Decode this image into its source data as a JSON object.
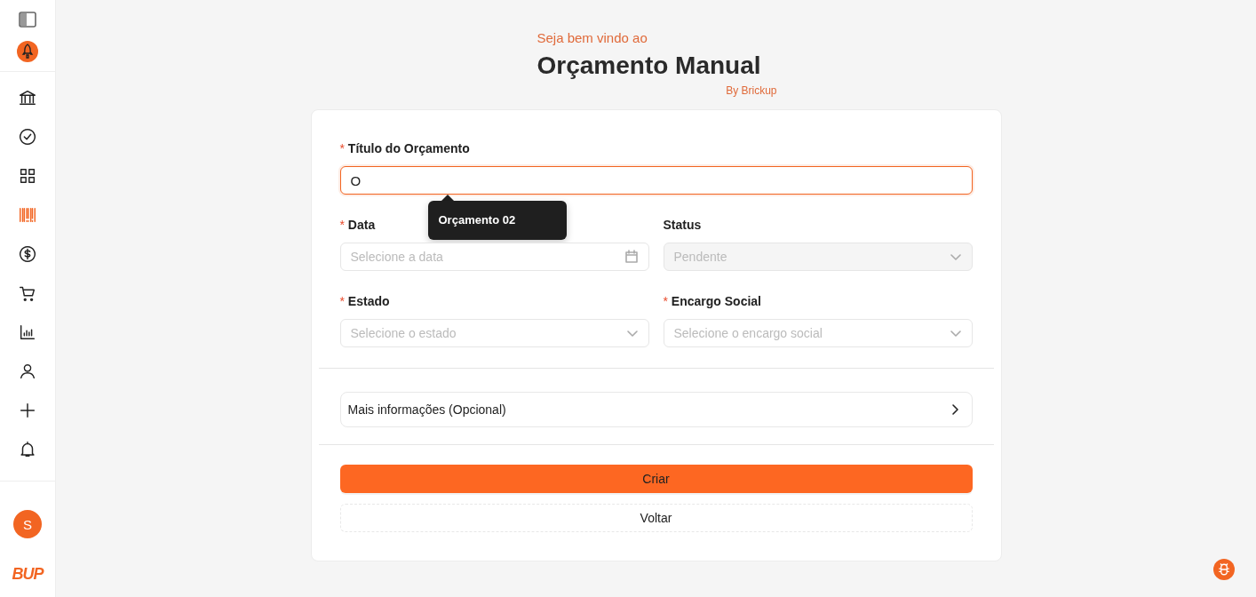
{
  "sidebar": {
    "nav": [
      {
        "kind": "bank",
        "selected": false
      },
      {
        "kind": "check",
        "selected": false
      },
      {
        "kind": "grid",
        "selected": false
      },
      {
        "kind": "barcode",
        "selected": true
      },
      {
        "kind": "dollar",
        "selected": false
      },
      {
        "kind": "cart",
        "selected": false
      },
      {
        "kind": "chart",
        "selected": false
      },
      {
        "kind": "user",
        "selected": false
      },
      {
        "kind": "plus",
        "selected": false
      },
      {
        "kind": "bell",
        "selected": false
      }
    ],
    "avatar": "S",
    "logo": "BUP"
  },
  "header": {
    "greeting": "Seja bem vindo ao",
    "title": "Orçamento Manual",
    "byline": "By Brickup"
  },
  "form": {
    "rows": [
      [
        {
          "kind": "text",
          "label": "Título do Orçamento",
          "required_mark": "*",
          "value": "O",
          "focused": true,
          "tooltip": "Orçamento 02"
        }
      ],
      [
        {
          "kind": "date",
          "label": "Data",
          "required_mark": "*",
          "placeholder": "Selecione a data"
        },
        {
          "kind": "select",
          "label": "Status",
          "value": "Pendente",
          "disabled": true
        }
      ],
      [
        {
          "kind": "select",
          "label": "Estado",
          "required_mark": "*",
          "placeholder": "Selecione o estado"
        },
        {
          "kind": "select",
          "label": "Encargo Social",
          "required_mark": "*",
          "placeholder": "Selecione o encargo social"
        }
      ]
    ],
    "collapse": {
      "label": "Mais informações (Opcional)",
      "expanded": false
    },
    "buttons": [
      {
        "label": "Criar",
        "kind": "primary"
      },
      {
        "label": "Voltar",
        "kind": "dashed"
      }
    ]
  }
}
